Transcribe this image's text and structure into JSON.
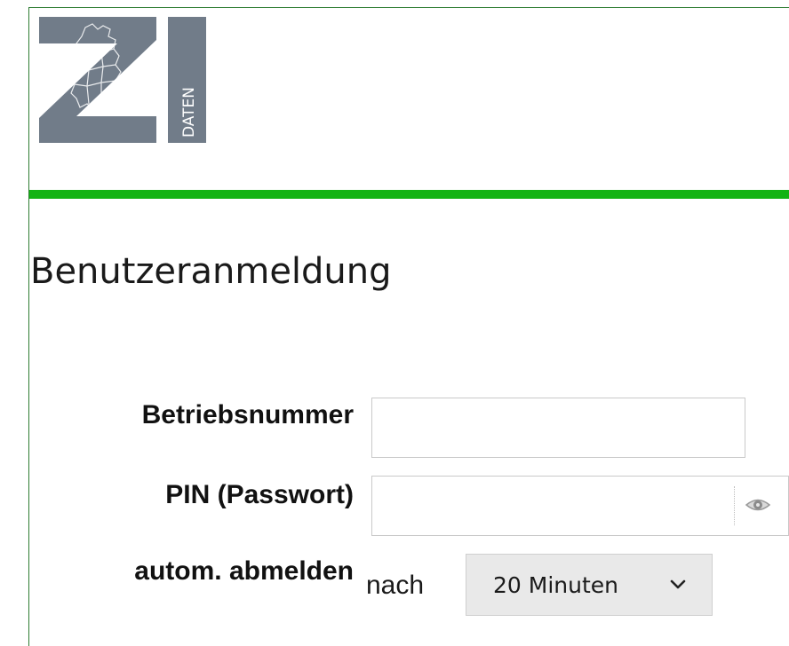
{
  "logo": {
    "letters": "ZI",
    "side_text": "DATEN",
    "color": "#717c89"
  },
  "accent_color": "#13b313",
  "login": {
    "title": "Benutzeranmeldung",
    "betriebsnummer": {
      "label": "Betriebsnummer",
      "value": "",
      "placeholder": ""
    },
    "pin": {
      "label": "PIN (Passwort)",
      "value": "",
      "placeholder": "",
      "toggle_icon": "eye-icon"
    },
    "auto_logout": {
      "label": "autom. abmelden",
      "prefix": "nach",
      "selected": "20 Minuten",
      "dropdown_icon": "chevron-down-icon"
    }
  }
}
